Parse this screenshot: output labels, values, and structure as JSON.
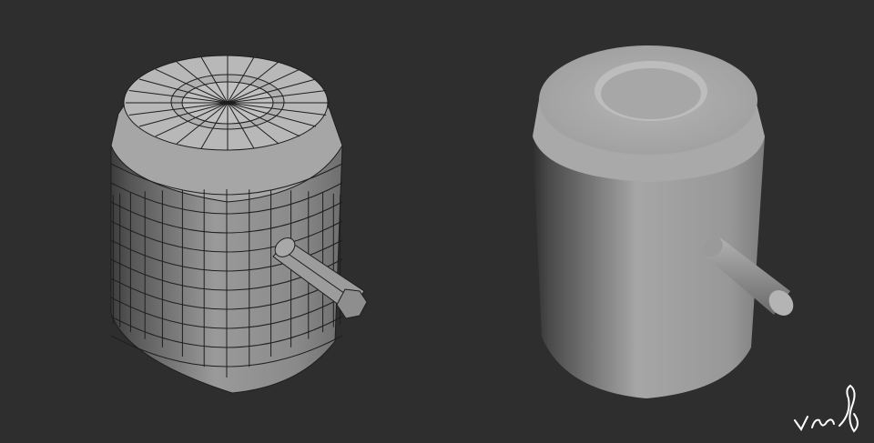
{
  "viewport": {
    "background": "#2e2e2e"
  },
  "models": [
    {
      "name": "wireframe-cylinder",
      "shading": "wireframe",
      "base_color": "#8c8c8c",
      "edge_color": "#1e1e1e"
    },
    {
      "name": "smooth-cylinder",
      "shading": "smooth",
      "base_color": "#9a9a9a"
    }
  ],
  "signature": {
    "color": "#ffffff"
  }
}
